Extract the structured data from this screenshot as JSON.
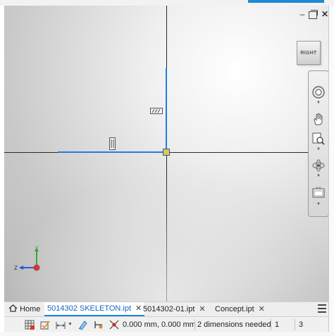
{
  "viewcube": {
    "face_label": "RIGHT"
  },
  "triad": {
    "y_label": "Y",
    "z_label": "Z",
    "x_color": "#c62828",
    "y_color": "#2e9e2e",
    "z_color": "#1e4fd8"
  },
  "sketch": {
    "line_color": "#1e7fe0",
    "axis_color": "#2a2a2a",
    "origin_color": "#e4c64a"
  },
  "navbar": {
    "tools": [
      "steering-wheel",
      "pan",
      "zoom-window",
      "orbit",
      "look-at"
    ]
  },
  "tabs": {
    "home_label": "Home",
    "items": [
      {
        "label": "5014302 SKELETON.ipt",
        "active": true
      },
      {
        "label": "5014302-01.ipt",
        "active": false
      },
      {
        "label": "Concept.ipt",
        "active": false
      }
    ],
    "close_glyph": "✕"
  },
  "status": {
    "coordinates": "0.000 mm, 0.000 mm",
    "message": "2 dimensions needed",
    "count_a": "1",
    "count_b": "3"
  },
  "window": {
    "minimize": "–",
    "close": "✕"
  }
}
